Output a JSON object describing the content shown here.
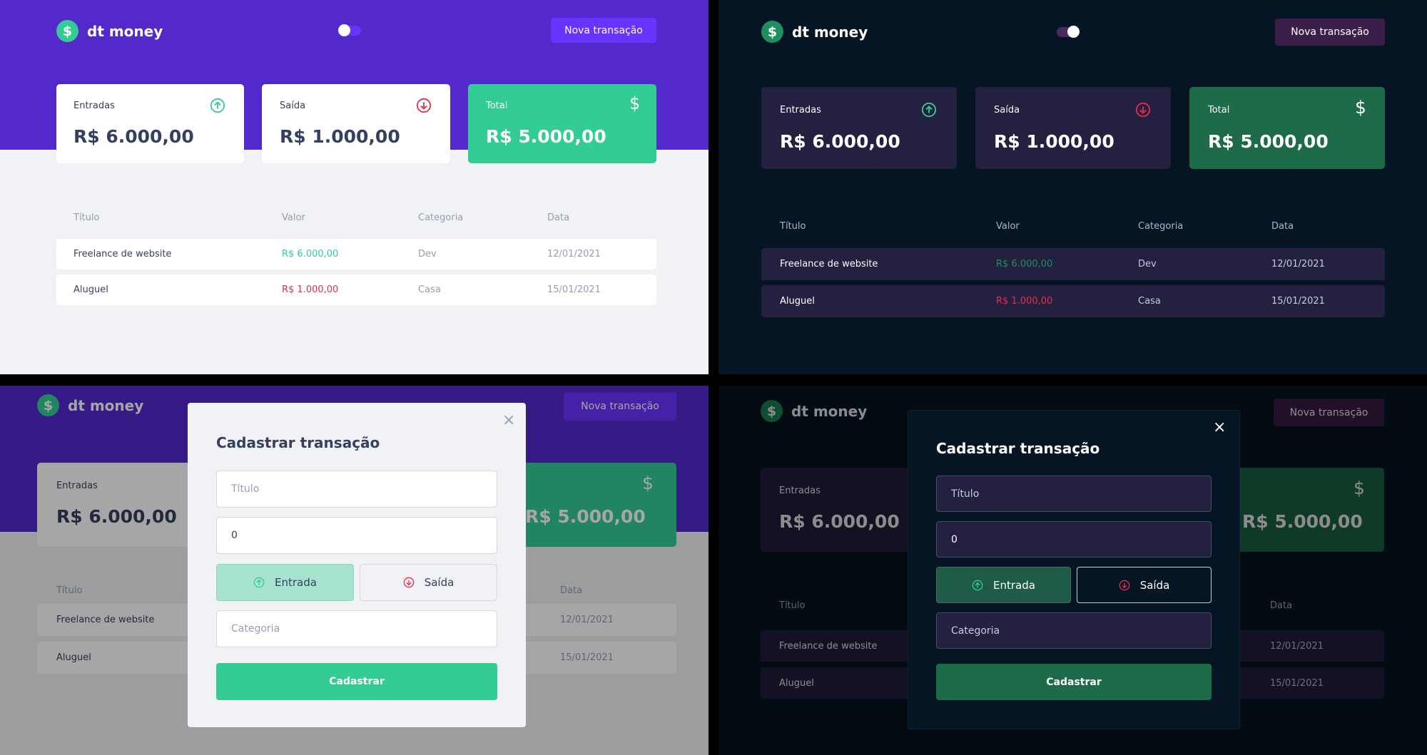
{
  "app": {
    "name": "dt money",
    "logo_symbol": "$",
    "new_transaction_label": "Nova transação"
  },
  "summary": {
    "income_label": "Entradas",
    "income_value": "R$ 6.000,00",
    "outcome_label": "Saída",
    "outcome_value": "R$ 1.000,00",
    "total_label": "Total",
    "total_value": "R$ 5.000,00",
    "total_icon_symbol": "$"
  },
  "table": {
    "headers": [
      "Título",
      "Valor",
      "Categoria",
      "Data"
    ],
    "rows": [
      {
        "title": "Freelance de website",
        "amount": "R$ 6.000,00",
        "type": "deposit",
        "category": "Dev",
        "date": "12/01/2021"
      },
      {
        "title": "Aluguel",
        "amount": "R$ 1.000,00",
        "type": "withdraw",
        "category": "Casa",
        "date": "15/01/2021"
      }
    ]
  },
  "modal": {
    "title": "Cadastrar transação",
    "close_symbol": "×",
    "title_placeholder": "Título",
    "amount_value": "0",
    "income_type_label": "Entrada",
    "outcome_type_label": "Saída",
    "category_placeholder": "Categoria",
    "submit_label": "Cadastrar"
  },
  "themes": {
    "light": {
      "state": "off",
      "accent": "#5429CC",
      "background": "#F0F2F5",
      "green": "#33CC95",
      "red": "#E52E4D",
      "text": "#363F5F"
    },
    "dark": {
      "state": "on",
      "accent": "#3B1F4A",
      "background": "#061523",
      "green": "#1E6B4A",
      "red": "#E52E4D",
      "text": "#FFFFFF"
    }
  },
  "icons": {
    "logo": "dollar-circle-icon",
    "income": "arrow-up-circle-icon",
    "outcome": "arrow-down-circle-icon",
    "total": "dollar-icon",
    "close": "close-icon"
  }
}
